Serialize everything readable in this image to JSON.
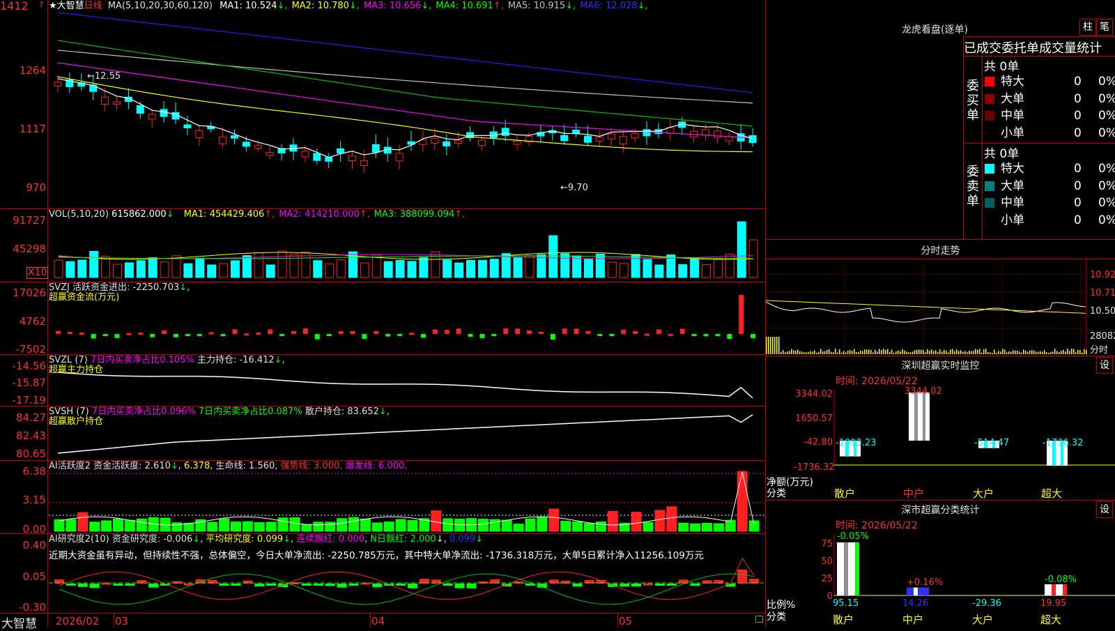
{
  "kline": {
    "star": "★",
    "name": "大智慧",
    "period": "日线",
    "ma_label": "MA(5,10,20,30,60,120)",
    "ma": [
      {
        "label": "MA1:",
        "value": "10.524",
        "arrow": "↓",
        "color": "#ffffff"
      },
      {
        "label": "MA2:",
        "value": "10.780",
        "arrow": "↓",
        "color": "#ffff00"
      },
      {
        "label": "MA3:",
        "value": "10.656",
        "arrow": "↓",
        "color": "#ff00ff"
      },
      {
        "label": "MA4:",
        "value": "10.691",
        "arrow": "↑",
        "color": "#00ff00"
      },
      {
        "label": "MA5:",
        "value": "10.915",
        "arrow": "↓",
        "color": "#c0c0c0"
      },
      {
        "label": "MA6:",
        "value": "12.028",
        "arrow": "↓",
        "color": "#3030ff"
      }
    ],
    "y_labels": [
      "1412",
      "1264",
      "1117",
      "970"
    ],
    "high_note": "12.55",
    "low_note": "9.70"
  },
  "vol": {
    "title": "VOL(5,10,20)",
    "value": "615862.000",
    "ma": [
      {
        "label": "MA1:",
        "value": "454429.406",
        "arrow": "↑",
        "color": "#ffff00"
      },
      {
        "label": "MA2:",
        "value": "414210.000",
        "arrow": "↑",
        "color": "#ff00ff"
      },
      {
        "label": "MA3:",
        "value": "388099.094",
        "arrow": "↑",
        "color": "#00ff00"
      }
    ],
    "y_labels": [
      "91727",
      "45298"
    ],
    "unit": "X10"
  },
  "svzj": {
    "line1": "SVZJ  活跃资金进出: -2250.703",
    "arrow": "↓",
    "line2": "超赢资金流(万元)",
    "y_labels": [
      "17026",
      "4762",
      "-7502"
    ]
  },
  "svzl": {
    "head": "SVZL (7)",
    "ratio": "7日内买卖净占比0.105%",
    "hold": "主力持仓: -16.412",
    "arrow": "↓",
    "line2": "超赢主力持仓",
    "y_labels": [
      "-14.56",
      "-15.87",
      "-17.19"
    ]
  },
  "svsh": {
    "head": "SVSH (7)",
    "ratio1": "7日内买卖净占比0.096%",
    "ratio2": "7日内买卖净占比0.087%",
    "hold": "散户持仓: 83.652",
    "arrow": "↓",
    "line2": "超赢散户持仓",
    "y_labels": [
      "84.27",
      "82.43",
      "80.65"
    ]
  },
  "ai1": {
    "head": "AI活跃度2 资金活跃度: 2.610",
    "v2": "6.378,",
    "life": "生命线: 1.560,",
    "strong": "强势线: 3.000,",
    "burst": "爆发线: 6.000,",
    "y_labels": [
      "6.38",
      "3.15",
      "0.00"
    ]
  },
  "ai2": {
    "head": "AI研究度2(10) 资金研究度: -0.006",
    "avg": "平均研究度: 0.099",
    "cont": "连续飘红: 0.000",
    "nday": "N日飘红: 2.000",
    "last": "0.099",
    "comment": "近期大资金虽有异动，但持续性不强，总体偏空，今日大单净流出: -2250.785万元，其中特大单净流出: -1736.318万元，大单5日累计净入11256.109万元",
    "y_labels": [
      "0.40",
      "0.05",
      "-0.30"
    ]
  },
  "bottom": {
    "name": "大智慧",
    "dates": [
      "2026/02",
      "03",
      "04",
      "05"
    ]
  },
  "right": {
    "dragon_title": "龙虎看盘(逐单)",
    "btn_col": "柱",
    "btn_pen": "笔",
    "table_title": "已成交委托单成交量统计",
    "buy_side": "委买单",
    "sell_side": "委卖单",
    "buy_total": "共 0单",
    "sell_total": "共 0单",
    "buy_rows": [
      {
        "name": "特大",
        "n": "0",
        "p": "0%",
        "color": "#ff0000"
      },
      {
        "name": "大单",
        "n": "0",
        "p": "0%",
        "color": "#8b0000"
      },
      {
        "name": "中单",
        "n": "0",
        "p": "0%",
        "color": "#6a0000"
      },
      {
        "name": "小单",
        "n": "0",
        "p": "0%",
        "color": ""
      }
    ],
    "sell_rows": [
      {
        "name": "特大",
        "n": "0",
        "p": "0%",
        "color": "#00ffff"
      },
      {
        "name": "大单",
        "n": "0",
        "p": "0%",
        "color": "#008080"
      },
      {
        "name": "中单",
        "n": "0",
        "p": "0%",
        "color": "#006060"
      },
      {
        "name": "小单",
        "n": "0",
        "p": "0%",
        "color": ""
      }
    ],
    "fenshi_title": "分时走势",
    "fenshi_labels": [
      "10.92",
      "10.71",
      "10.50"
    ],
    "fenshi_vol": "28082",
    "fenshi_unit": "分时",
    "sz_title": "深圳超赢实时监控",
    "sz_set": "设",
    "sz_time": "时间: 2026/05/22",
    "sz_y": [
      "3344.02",
      "1650.57",
      "-42.80",
      "-1736.32"
    ],
    "sz_vals": [
      "-1093.23",
      "3344.02",
      "-514.47",
      "-1736.32"
    ],
    "sz_unit": "净额(万元)",
    "sz_class": "分类",
    "cats": [
      "散户",
      "中户",
      "大户",
      "超大"
    ],
    "ss_title": "深市超赢分类统计",
    "ss_set": "设",
    "ss_time": "时间: 2026/05/22",
    "ss_y": [
      "75",
      "50",
      "25",
      "0"
    ],
    "ss_top": [
      "-0.05%",
      "+0.16%",
      "",
      "-0.08%"
    ],
    "ss_vals": [
      "95.15",
      "14.26",
      "-29.36",
      "19.95"
    ],
    "ss_unit": "比例%",
    "ss_class": "分类"
  }
}
